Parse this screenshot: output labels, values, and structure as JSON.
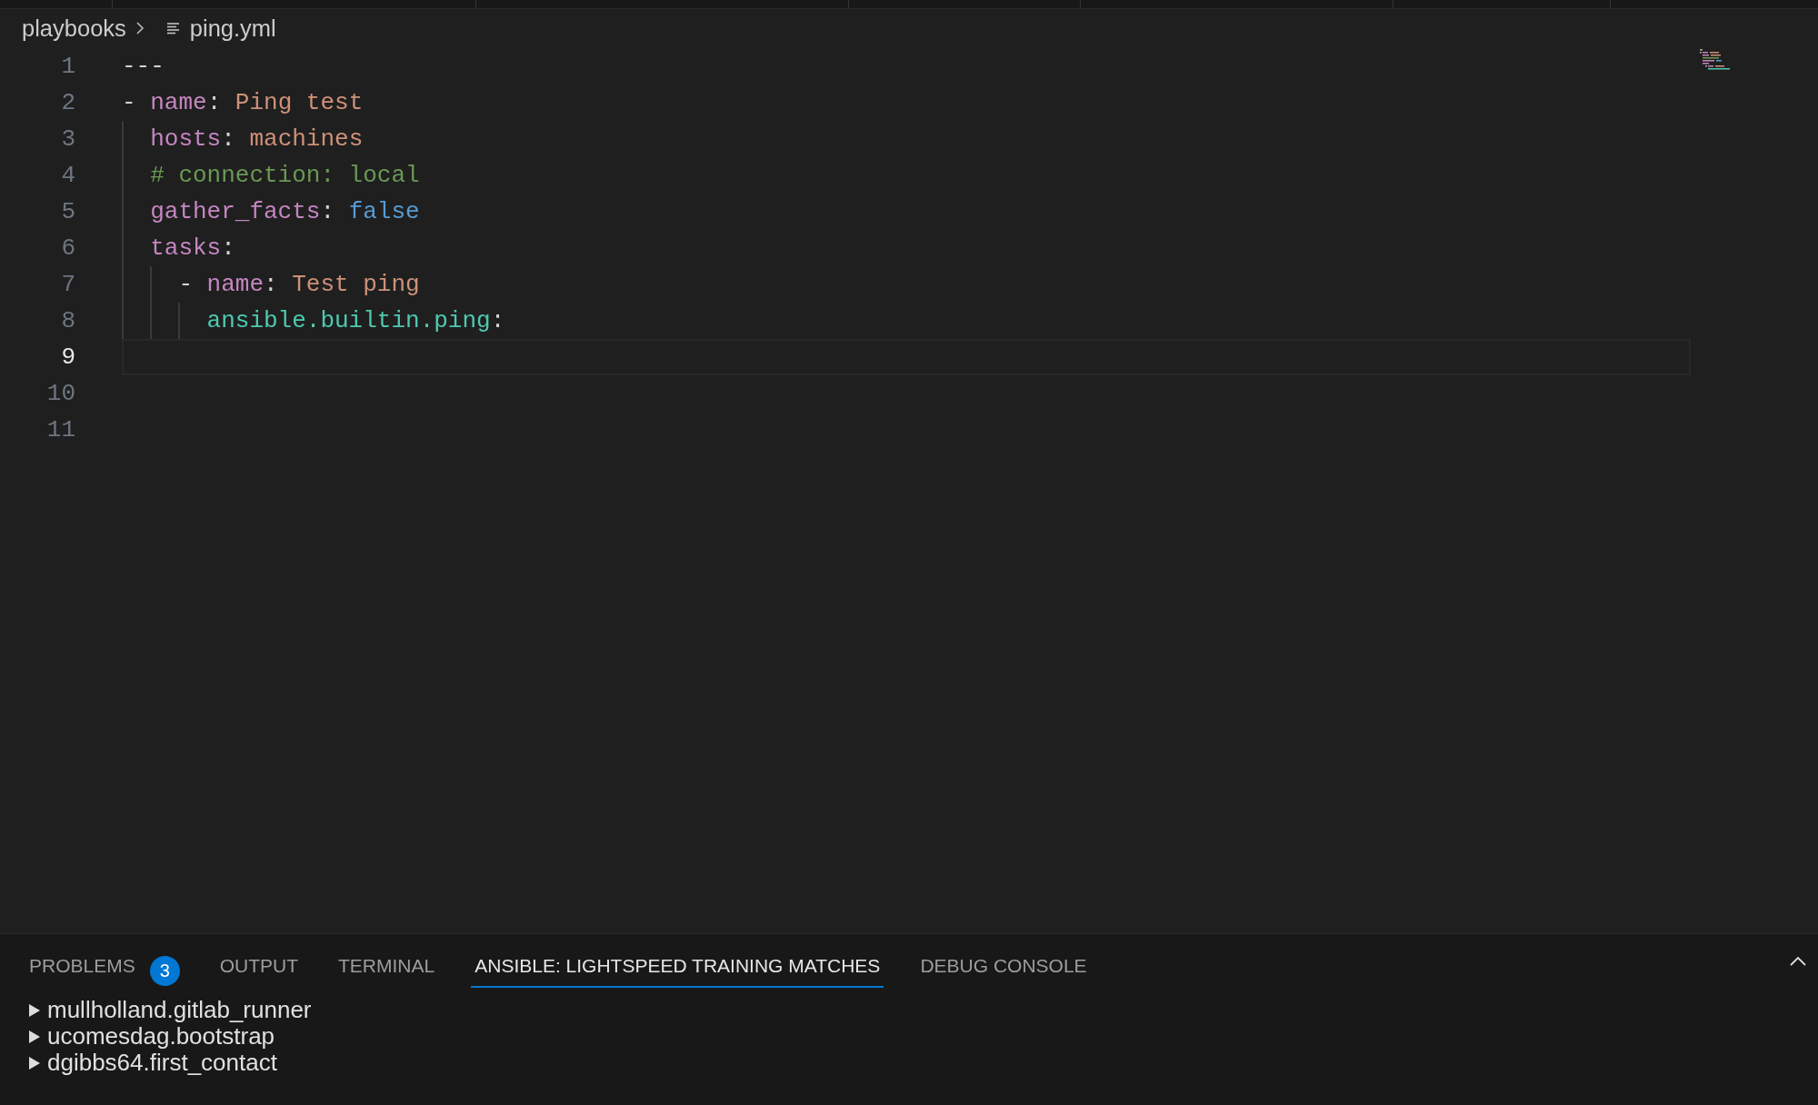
{
  "breadcrumb": {
    "folder": "playbooks",
    "file": "ping.yml"
  },
  "editor": {
    "lines": [
      {
        "number": "1",
        "current": false,
        "tokens": [
          {
            "kind": "plain",
            "text": "---"
          }
        ]
      },
      {
        "number": "2",
        "current": false,
        "tokens": [
          {
            "kind": "plain",
            "text": "- "
          },
          {
            "kind": "key",
            "text": "name"
          },
          {
            "kind": "plain",
            "text": ": "
          },
          {
            "kind": "string",
            "text": "Ping test"
          }
        ],
        "children": [
          {
            "number": "3",
            "current": false,
            "tokens": [
              {
                "kind": "key",
                "text": "hosts"
              },
              {
                "kind": "plain",
                "text": ": "
              },
              {
                "kind": "string",
                "text": "machines"
              }
            ]
          },
          {
            "number": "4",
            "current": false,
            "tokens": [
              {
                "kind": "comment",
                "text": "# connection: local"
              }
            ]
          },
          {
            "number": "5",
            "current": false,
            "tokens": [
              {
                "kind": "key",
                "text": "gather_facts"
              },
              {
                "kind": "plain",
                "text": ": "
              },
              {
                "kind": "bool",
                "text": "false"
              }
            ]
          },
          {
            "number": "6",
            "current": false,
            "tokens": [
              {
                "kind": "key",
                "text": "tasks"
              },
              {
                "kind": "plain",
                "text": ":"
              }
            ],
            "children": [
              {
                "number": "7",
                "current": false,
                "tokens": [
                  {
                    "kind": "plain",
                    "text": "- "
                  },
                  {
                    "kind": "key",
                    "text": "name"
                  },
                  {
                    "kind": "plain",
                    "text": ": "
                  },
                  {
                    "kind": "string",
                    "text": "Test ping"
                  }
                ],
                "children": [
                  {
                    "number": "8",
                    "current": false,
                    "tokens": [
                      {
                        "kind": "module",
                        "text": "ansible.builtin.ping"
                      },
                      {
                        "kind": "plain",
                        "text": ":"
                      }
                    ]
                  }
                ]
              }
            ]
          }
        ]
      },
      {
        "number": "9",
        "current": true
      },
      {
        "number": "10",
        "current": false
      },
      {
        "number": "11",
        "current": false
      }
    ]
  },
  "panel": {
    "tabs": [
      {
        "label": "PROBLEMS",
        "badge": "3",
        "selected": false
      },
      {
        "label": "OUTPUT",
        "selected": false
      },
      {
        "label": "TERMINAL",
        "selected": false
      },
      {
        "label": "ANSIBLE: LIGHTSPEED TRAINING MATCHES",
        "selected": true
      },
      {
        "label": "DEBUG CONSOLE",
        "selected": false
      }
    ],
    "tree": [
      {
        "label": "mullholland.gitlab_runner",
        "expanded": false
      },
      {
        "label": "ucomesdag.bootstrap",
        "expanded": false
      },
      {
        "label": "dgibbs64.first_contact",
        "expanded": false
      }
    ]
  }
}
